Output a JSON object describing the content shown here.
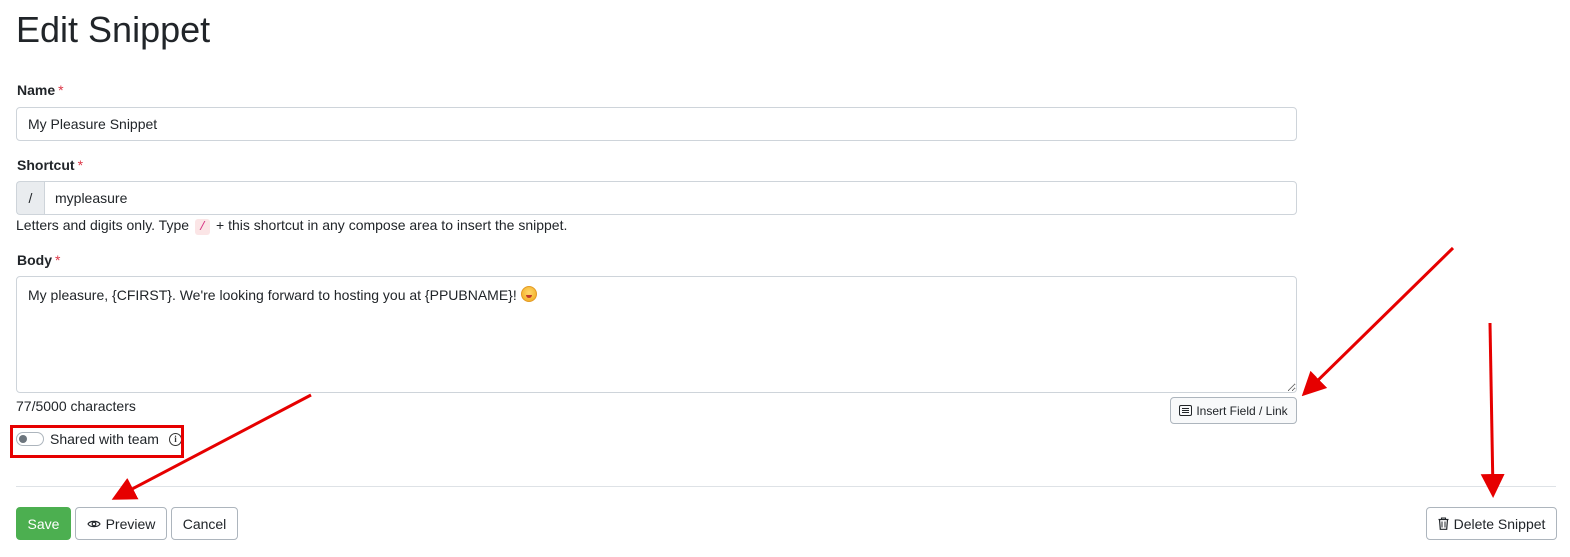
{
  "page": {
    "title": "Edit Snippet"
  },
  "form": {
    "name": {
      "label": "Name",
      "required_mark": "*",
      "value": "My Pleasure Snippet"
    },
    "shortcut": {
      "label": "Shortcut",
      "required_mark": "*",
      "prefix": "/",
      "value": "mypleasure",
      "help_before": "Letters and digits only. Type",
      "help_code": "/",
      "help_after": "+ this shortcut in any compose area to insert the snippet."
    },
    "body": {
      "label": "Body",
      "required_mark": "*",
      "value": "My pleasure, {CFIRST}. We're looking forward to hosting you at {PPUBNAME}!",
      "emoji_icon": "grinning-face-emoji",
      "char_count": "77/5000 characters",
      "insert_button_label": "Insert Field / Link"
    },
    "shared": {
      "label": "Shared with team",
      "checked": false
    }
  },
  "actions": {
    "save_label": "Save",
    "preview_label": "Preview",
    "cancel_label": "Cancel",
    "delete_label": "Delete Snippet"
  },
  "annotations": {
    "color": "#e60000"
  },
  "colors": {
    "save_button": "#4caf50",
    "required": "#dc3545"
  }
}
